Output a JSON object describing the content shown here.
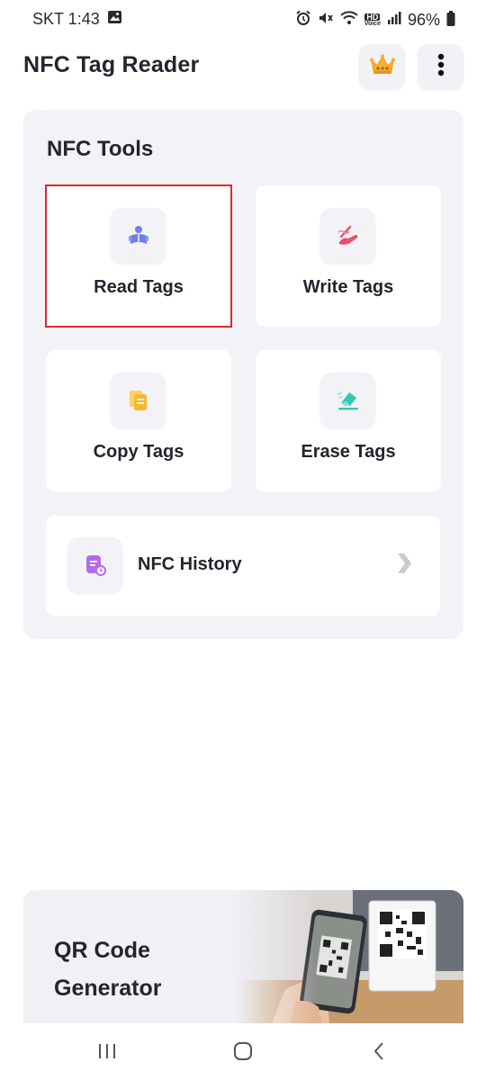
{
  "status_bar": {
    "carrier_time": "SKT 1:43",
    "battery": "96%",
    "icons": [
      "gallery-icon",
      "alarm-icon",
      "mute-icon",
      "wifi-icon",
      "hd-voice-icon",
      "signal-icon",
      "battery-icon"
    ],
    "hd_label": "HD",
    "voice_label": "Voice"
  },
  "header": {
    "title": "NFC Tag Reader",
    "crown_icon": "crown-icon",
    "menu_icon": "more-vertical-icon"
  },
  "tools": {
    "title": "NFC Tools",
    "cards": [
      {
        "label": "Read Tags",
        "icon": "reader-icon",
        "color": "#6f7fe8",
        "selected": true
      },
      {
        "label": "Write Tags",
        "icon": "write-hand-icon",
        "color": "#e8506a",
        "selected": false
      },
      {
        "label": "Copy Tags",
        "icon": "copy-icon",
        "color": "#f6b92f",
        "selected": false
      },
      {
        "label": "Erase Tags",
        "icon": "eraser-icon",
        "color": "#2ec9b2",
        "selected": false
      }
    ],
    "history": {
      "label": "NFC History",
      "icon": "history-doc-icon",
      "color": "#b46be8"
    }
  },
  "banner": {
    "title_line1": "QR Code",
    "title_line2": "Generator"
  },
  "nav": {
    "recents_icon": "recents-icon",
    "home_icon": "home-icon",
    "back_icon": "back-icon"
  },
  "colors": {
    "selection_outline": "#d92b2b",
    "panel_bg": "#f2f2f7",
    "text": "#23242f"
  }
}
